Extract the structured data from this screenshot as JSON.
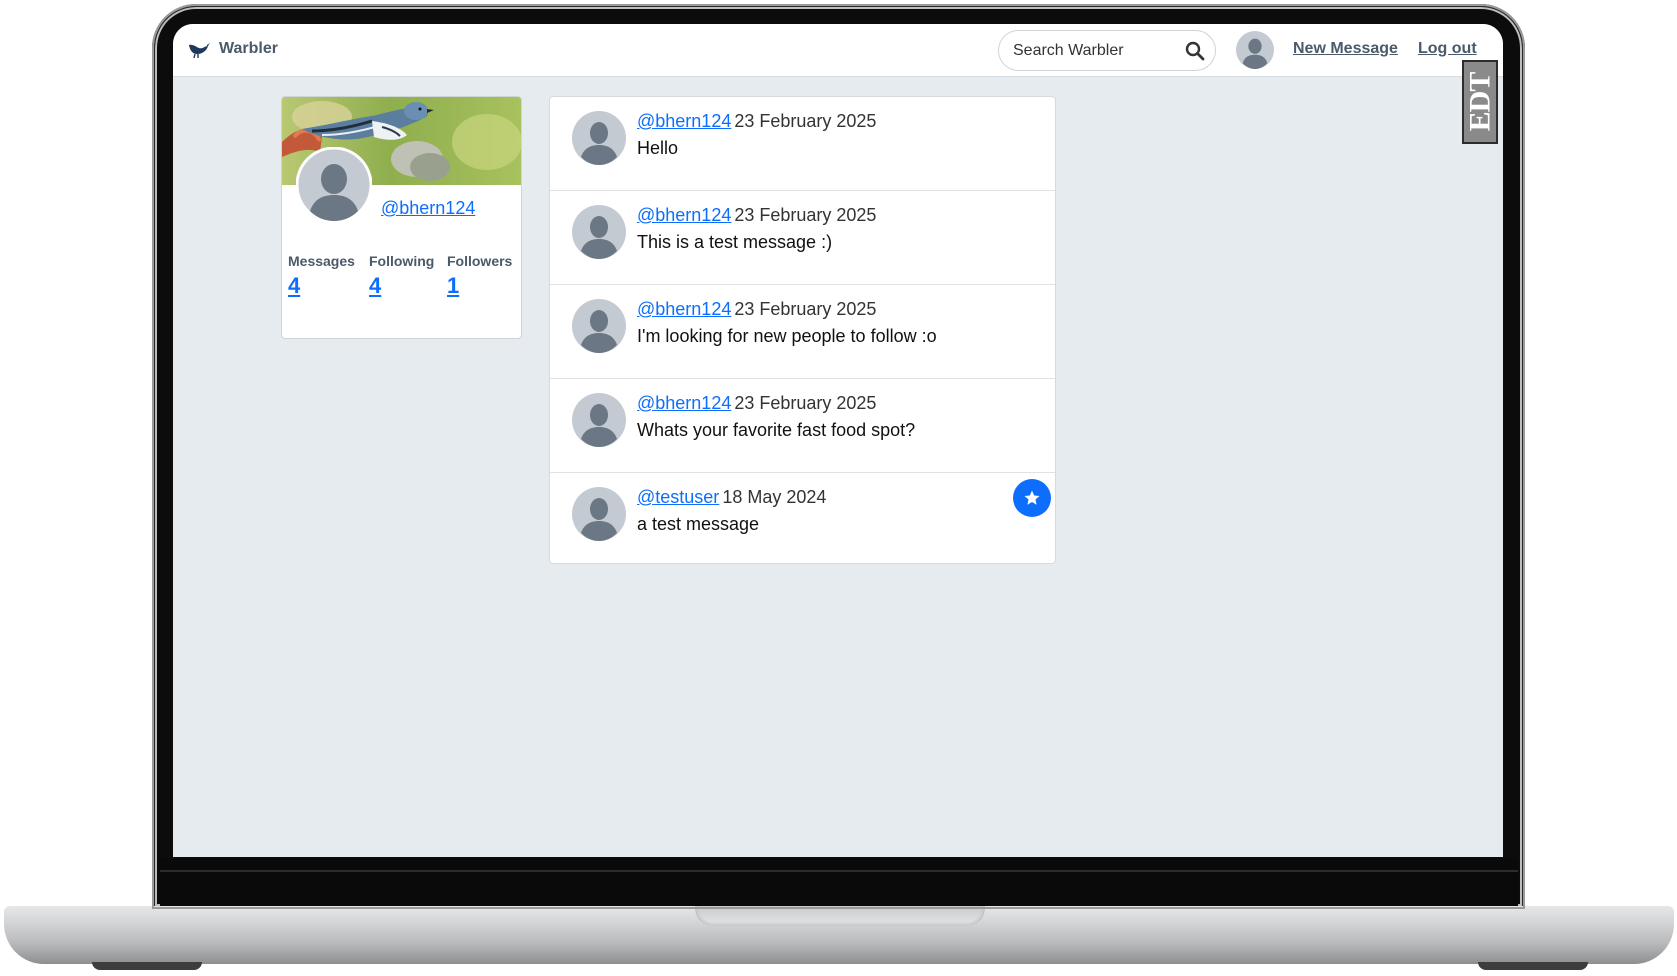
{
  "app": {
    "name": "Warbler"
  },
  "search": {
    "placeholder": "Search Warbler"
  },
  "nav": {
    "new_message": "New Message",
    "logout": "Log out"
  },
  "badge": {
    "text": "EDT"
  },
  "profile": {
    "username": "@bhern124",
    "stats": [
      {
        "label": "Messages",
        "value": "4"
      },
      {
        "label": "Following",
        "value": "4"
      },
      {
        "label": "Followers",
        "value": "1"
      }
    ]
  },
  "messages": [
    {
      "user": "@bhern124",
      "date": "23 February 2025",
      "text": "Hello",
      "liked": false
    },
    {
      "user": "@bhern124",
      "date": "23 February 2025",
      "text": "This is a test message :)",
      "liked": false
    },
    {
      "user": "@bhern124",
      "date": "23 February 2025",
      "text": "I'm looking for new people to follow :o",
      "liked": false
    },
    {
      "user": "@bhern124",
      "date": "23 February 2025",
      "text": "Whats your favorite fast food spot?",
      "liked": false
    },
    {
      "user": "@testuser",
      "date": "18 May 2024",
      "text": "a test message",
      "liked": true
    }
  ],
  "colors": {
    "link": "#0d6efd",
    "star_button": "#0d6efd",
    "page_bg": "#e6ebf0"
  },
  "icons": {
    "search": "search-icon",
    "star": "star-icon",
    "avatar": "default-avatar-icon",
    "logo": "bird-logo-icon"
  }
}
